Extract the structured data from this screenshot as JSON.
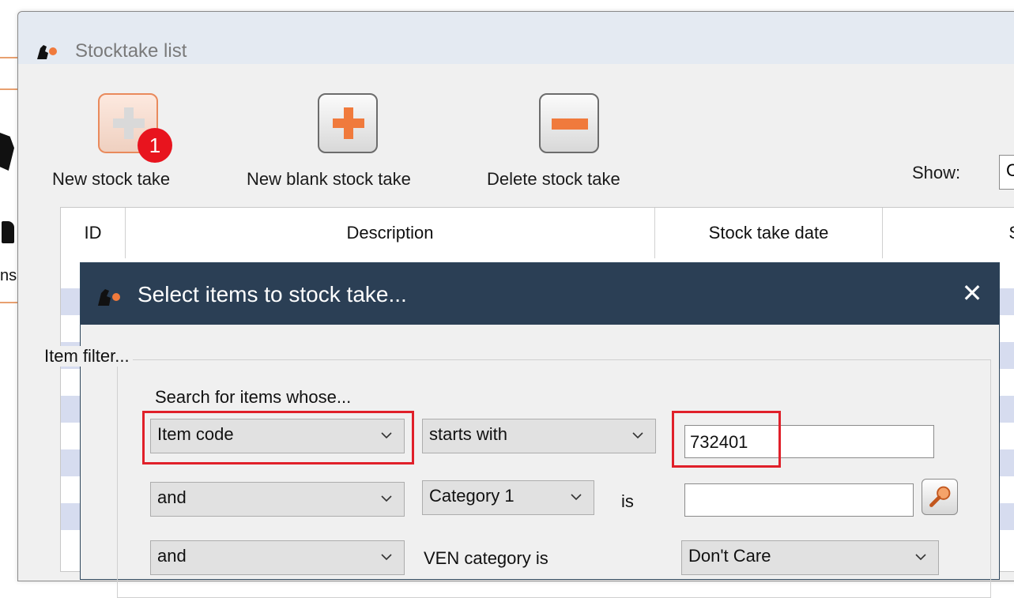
{
  "background_app": {
    "partial_text": "ns"
  },
  "main_window": {
    "title": "Stocktake list",
    "toolbar": {
      "new_stock_take": "New stock take",
      "new_blank_stock_take": "New blank stock take",
      "delete_stock_take": "Delete stock take"
    },
    "step_badge": "1",
    "show_label": "Show:",
    "show_value": "C",
    "table_headers": [
      "ID",
      "Description",
      "Stock take date",
      "S"
    ]
  },
  "dialog": {
    "title": "Select items to stock take...",
    "item_filter_legend": "Item filter...",
    "search_label": "Search for items whose...",
    "row1": {
      "field": "Item code",
      "operator": "starts with",
      "value": "732401"
    },
    "row2": {
      "conjunction": "and",
      "field": "Category 1",
      "is_label": "is",
      "value": ""
    },
    "row3": {
      "conjunction": "and",
      "label": "VEN category is",
      "value": "Don't Care"
    }
  },
  "colors": {
    "highlight": "#e0202a",
    "badge": "#e8141e",
    "accent_orange": "#f07a3c",
    "dialog_title_bg": "#2b3f55",
    "row_stripe": "#d6dcef"
  },
  "icons": [
    "app-logo-icon",
    "plus-icon",
    "minus-icon",
    "close-icon",
    "chevron-down-icon",
    "lookup-search-icon"
  ]
}
